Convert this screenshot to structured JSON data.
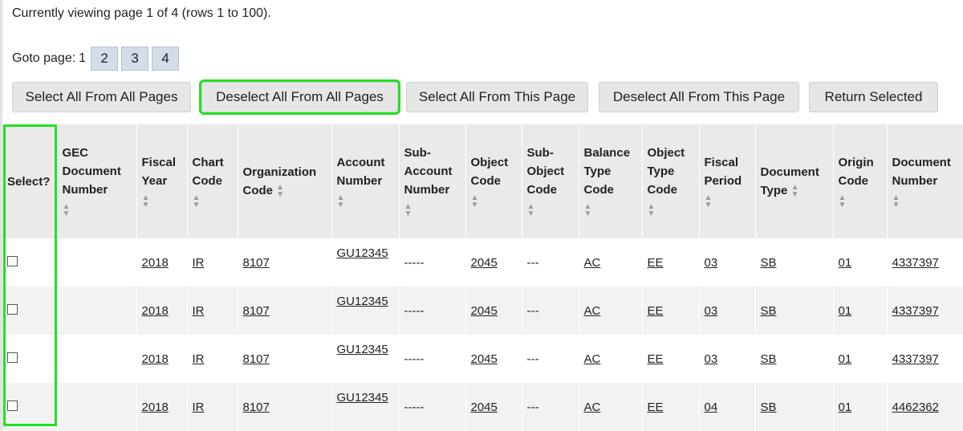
{
  "status_text": "Currently viewing page 1 of 4 (rows 1 to 100).",
  "goto": {
    "label": "Goto page:",
    "current": "1",
    "pages": [
      "2",
      "3",
      "4"
    ]
  },
  "actions": {
    "select_all_pages": "Select All From All Pages",
    "deselect_all_pages": "Deselect All From All Pages",
    "select_all_this_page": "Select All From This Page",
    "deselect_all_this_page": "Deselect All From This Page",
    "return_selected": "Return Selected"
  },
  "headers": {
    "select": "Select?",
    "gec_document_number": "GEC Document Number",
    "fiscal_year": "Fiscal Year",
    "chart_code": "Chart Code",
    "organization_code": "Organization Code",
    "account_number": "Account Number",
    "sub_account_number": "Sub-Account Number",
    "object_code": "Object Code",
    "sub_object_code": "Sub-Object Code",
    "balance_type_code": "Balance Type Code",
    "object_type_code": "Object Type Code",
    "fiscal_period": "Fiscal Period",
    "document_type": "Document Type",
    "origin_code": "Origin Code",
    "document_number": "Document Number"
  },
  "rows": [
    {
      "gec": "",
      "fiscal_year": "2018",
      "chart": "IR",
      "org": "8107",
      "account": "GU12345",
      "sub_account": "-----",
      "object": "2045",
      "sub_object": "---",
      "balance_type": "AC",
      "object_type": "EE",
      "period": "03",
      "doc_type": "SB",
      "origin": "01",
      "doc_number": "4337397"
    },
    {
      "gec": "",
      "fiscal_year": "2018",
      "chart": "IR",
      "org": "8107",
      "account": "GU12345",
      "sub_account": "-----",
      "object": "2045",
      "sub_object": "---",
      "balance_type": "AC",
      "object_type": "EE",
      "period": "03",
      "doc_type": "SB",
      "origin": "01",
      "doc_number": "4337397"
    },
    {
      "gec": "",
      "fiscal_year": "2018",
      "chart": "IR",
      "org": "8107",
      "account": "GU12345",
      "sub_account": "-----",
      "object": "2045",
      "sub_object": "---",
      "balance_type": "AC",
      "object_type": "EE",
      "period": "03",
      "doc_type": "SB",
      "origin": "01",
      "doc_number": "4337397"
    },
    {
      "gec": "",
      "fiscal_year": "2018",
      "chart": "IR",
      "org": "8107",
      "account": "GU12345",
      "sub_account": "-----",
      "object": "2045",
      "sub_object": "---",
      "balance_type": "AC",
      "object_type": "EE",
      "period": "04",
      "doc_type": "SB",
      "origin": "01",
      "doc_number": "4462362"
    }
  ],
  "colors": {
    "highlight": "#22e022",
    "page_button": "#d4dce8",
    "header_bg": "#eaeaea",
    "stripe": "#f2f2f2"
  },
  "icons": {
    "sort": "sort-arrows-icon",
    "checkbox": "checkbox"
  }
}
